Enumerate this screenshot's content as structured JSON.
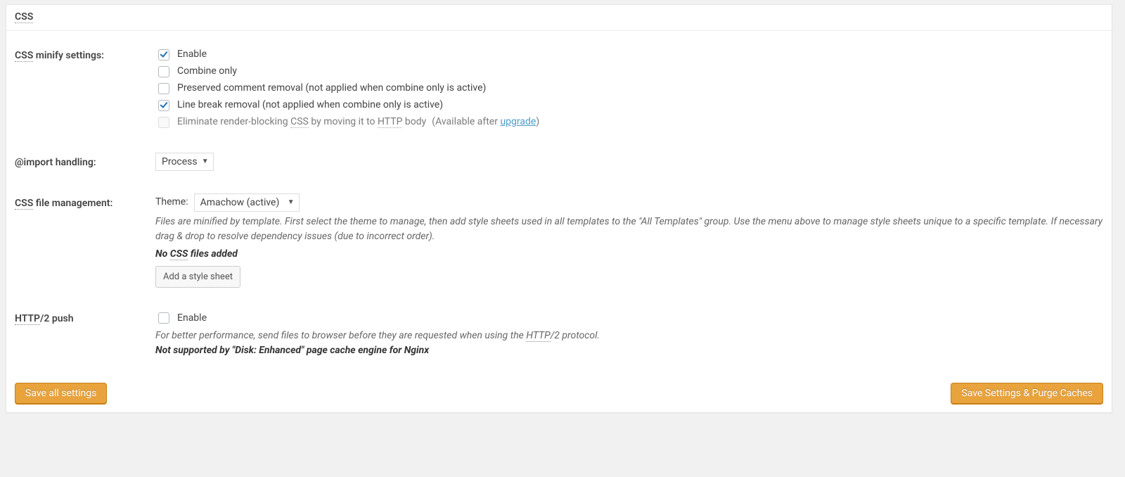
{
  "section_title_abbr": "CSS",
  "labels": {
    "css_minify_settings_abbr": "CSS",
    "css_minify_settings_suffix": " minify settings:",
    "import_handling": "@import handling:",
    "css_file_management_abbr": "CSS",
    "css_file_management_suffix": " file management:",
    "http2_push_abbr": "HTTP",
    "http2_push_suffix": "/2 push"
  },
  "checkbox": {
    "enable": "Enable",
    "combine_only": "Combine only",
    "preserved_comment": "Preserved comment removal (not applied when combine only is active)",
    "line_break": "Line break removal (not applied when combine only is active)",
    "eliminate_pre": "Eliminate render-blocking ",
    "eliminate_abbr": "CSS",
    "eliminate_mid": " by moving it to ",
    "eliminate_abbr2": "HTTP",
    "eliminate_post": " body ",
    "upgrade_note_pre": "(Available after ",
    "upgrade_link": "upgrade",
    "upgrade_note_post": ")"
  },
  "import_handling": {
    "selected": "Process"
  },
  "file_management": {
    "theme_label": "Theme:",
    "theme_selected": "Amachow (active)",
    "description": "Files are minified by template. First select the theme to manage, then add style sheets used in all templates to the \"All Templates\" group. Use the menu above to manage style sheets unique to a specific template. If necessary drag & drop to resolve dependency issues (due to incorrect order).",
    "no_files_pre": "No ",
    "no_files_abbr": "CSS",
    "no_files_post": " files added",
    "add_button": "Add a style sheet"
  },
  "http2": {
    "enable": "Enable",
    "desc_pre": "For better performance, send files to browser before they are requested when using the ",
    "desc_abbr": "HTTP",
    "desc_post": "/2 protocol.",
    "not_supported": "Not supported by \"Disk: Enhanced\" page cache engine for Nginx"
  },
  "buttons": {
    "save_all": "Save all settings",
    "save_purge": "Save Settings & Purge Caches"
  },
  "state": {
    "enable_checked": true,
    "combine_only_checked": false,
    "preserved_checked": false,
    "line_break_checked": true,
    "eliminate_checked": false,
    "http2_enable_checked": false
  }
}
